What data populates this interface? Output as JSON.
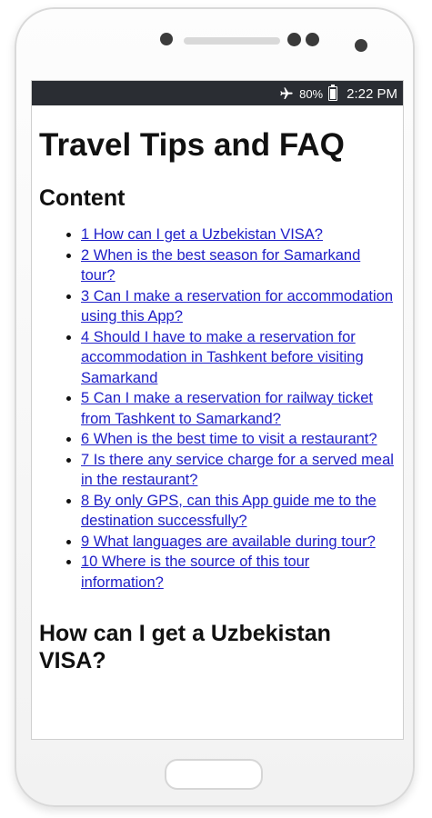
{
  "status_bar": {
    "battery": "80%",
    "time": "2:22 PM",
    "icons": [
      "airplane-icon",
      "battery-icon"
    ]
  },
  "page": {
    "title": "Travel Tips and FAQ",
    "content_heading": "Content",
    "toc": [
      "1 How can I get a Uzbekistan VISA?",
      "2 When is the best season for Samarkand tour?",
      "3 Can I make a reservation for accommodation using this App?",
      "4 Should I have to make a reservation for accommodation in Tashkent before visiting Samarkand",
      "5 Can I make a reservation for railway ticket from Tashkent to Samarkand?",
      "6 When is the best time to visit a restaurant?",
      "7 Is there any service charge for a served meal in the restaurant?",
      "8 By only GPS, can this App guide me to the destination successfully?",
      "9 What languages are available during tour?",
      "10 Where is the source of this tour information?"
    ],
    "first_question_heading": "How can I get a Uzbekistan VISA?"
  },
  "colors": {
    "status_bar_bg": "#2a2d33",
    "link": "#2020c8"
  }
}
